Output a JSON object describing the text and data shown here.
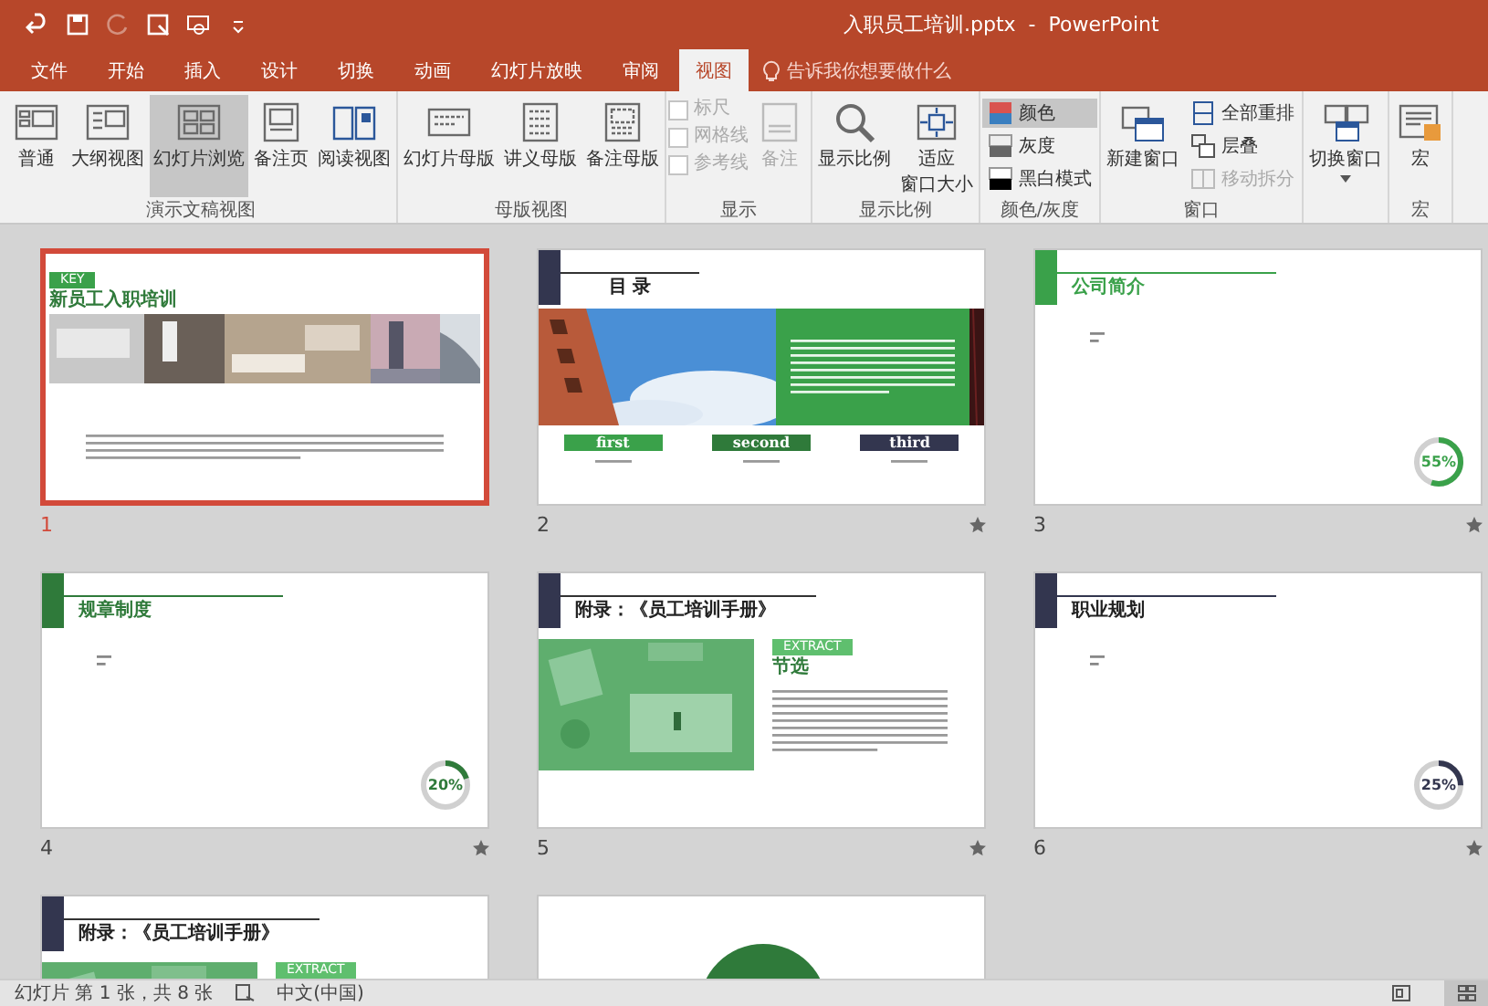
{
  "window": {
    "title": "入职员工培训.pptx  -  PowerPoint"
  },
  "quick_access": [
    {
      "kind": "undo",
      "disabled": false
    },
    {
      "kind": "save",
      "disabled": false
    },
    {
      "kind": "redo",
      "disabled": true
    },
    {
      "kind": "present",
      "disabled": false
    },
    {
      "kind": "touch",
      "disabled": false
    },
    {
      "kind": "more",
      "disabled": false
    }
  ],
  "tabs": [
    {
      "label": "文件",
      "selected": false
    },
    {
      "label": "开始",
      "selected": false
    },
    {
      "label": "插入",
      "selected": false
    },
    {
      "label": "设计",
      "selected": false
    },
    {
      "label": "切换",
      "selected": false
    },
    {
      "label": "动画",
      "selected": false
    },
    {
      "label": "幻灯片放映",
      "selected": false
    },
    {
      "label": "审阅",
      "selected": false
    },
    {
      "label": "视图",
      "selected": true
    }
  ],
  "tell_me": {
    "placeholder": "告诉我你想要做什么"
  },
  "ribbon_groups": [
    {
      "label": "演示文稿视图",
      "items": [
        {
          "kind": "large",
          "label": "普通",
          "selected": false,
          "disabled": false
        },
        {
          "kind": "large",
          "label": "大纲视图",
          "selected": false,
          "disabled": false
        },
        {
          "kind": "large",
          "label": "幻灯片浏览",
          "selected": true,
          "disabled": false
        },
        {
          "kind": "large",
          "label": "备注页",
          "selected": false,
          "disabled": false
        },
        {
          "kind": "large",
          "label": "阅读视图",
          "selected": false,
          "disabled": false
        }
      ]
    },
    {
      "label": "母版视图",
      "items": [
        {
          "kind": "large",
          "label": "幻灯片母版",
          "selected": false,
          "disabled": false
        },
        {
          "kind": "large",
          "label": "讲义母版",
          "selected": false,
          "disabled": false
        },
        {
          "kind": "large",
          "label": "备注母版",
          "selected": false,
          "disabled": false
        }
      ]
    },
    {
      "label": "显示",
      "items": [
        {
          "kind": "checks",
          "checks": [
            {
              "label": "标尺",
              "checked": false,
              "disabled": true
            },
            {
              "label": "网格线",
              "checked": false,
              "disabled": true
            },
            {
              "label": "参考线",
              "checked": false,
              "disabled": true
            }
          ]
        },
        {
          "kind": "large",
          "label": "备注",
          "selected": false,
          "disabled": true
        }
      ]
    },
    {
      "label": "显示比例",
      "items": [
        {
          "kind": "large",
          "label": "显示比例",
          "selected": false,
          "disabled": false
        },
        {
          "kind": "large",
          "label_lines": [
            "适应",
            "窗口大小"
          ],
          "selected": false,
          "disabled": false
        }
      ]
    },
    {
      "label": "颜色/灰度",
      "items": [
        {
          "kind": "smalls",
          "smalls": [
            {
              "label": "颜色",
              "selected": true,
              "disabled": false
            },
            {
              "label": "灰度",
              "selected": false,
              "disabled": false
            },
            {
              "label": "黑白模式",
              "selected": false,
              "disabled": false
            }
          ]
        }
      ]
    },
    {
      "label": "窗口",
      "items": [
        {
          "kind": "large",
          "label": "新建窗口",
          "selected": false,
          "disabled": false
        },
        {
          "kind": "smalls",
          "smalls": [
            {
              "label": "全部重排",
              "selected": false,
              "disabled": false
            },
            {
              "label": "层叠",
              "selected": false,
              "disabled": false
            },
            {
              "label": "移动拆分",
              "selected": false,
              "disabled": true
            }
          ]
        }
      ]
    },
    {
      "items": [
        {
          "kind": "large",
          "label": "切换窗口",
          "selected": false,
          "disabled": false,
          "dropdown": true
        }
      ]
    },
    {
      "label": "宏",
      "items": [
        {
          "kind": "large",
          "label": "宏",
          "selected": false,
          "disabled": false
        }
      ]
    }
  ],
  "slides": [
    {
      "number": "1",
      "kind": "cover",
      "selected": true,
      "animated": false,
      "badge": "KEY",
      "title": "新员工入职培训"
    },
    {
      "number": "2",
      "kind": "toc",
      "selected": false,
      "animated": true,
      "title": "目 录",
      "labels": [
        {
          "text": "first",
          "color": "#3aa14a"
        },
        {
          "text": "second",
          "color": "#2f7a3a"
        },
        {
          "text": "third",
          "color": "#33364f"
        }
      ]
    },
    {
      "number": "3",
      "kind": "section",
      "selected": false,
      "animated": true,
      "title": "公司简介",
      "color": "#3aa14a",
      "percent": "55%",
      "level": 0.55
    },
    {
      "number": "4",
      "kind": "section",
      "selected": false,
      "animated": true,
      "title": "规章制度",
      "color": "#2f7a3a",
      "percent": "20%",
      "level": 0.2
    },
    {
      "number": "5",
      "kind": "appendix",
      "selected": false,
      "animated": true,
      "title": "附录：《员工培训手册》",
      "badge": "EXTRACT",
      "subtitle": "节选"
    },
    {
      "number": "6",
      "kind": "section",
      "selected": false,
      "animated": true,
      "title": "职业规划",
      "color": "#33364f",
      "percent": "25%",
      "level": 0.25
    },
    {
      "kind": "appendix",
      "selected": false,
      "title": "附录：《员工培训手册》",
      "badge": "EXTRACT"
    },
    {
      "kind": "closing",
      "selected": false
    }
  ],
  "status_bar": {
    "slide_info": "幻灯片 第 1 张，共 8 张",
    "language": "中文(中国)",
    "views": [
      {
        "kind": "normal",
        "selected": false
      },
      {
        "kind": "sorter",
        "selected": true
      }
    ]
  }
}
